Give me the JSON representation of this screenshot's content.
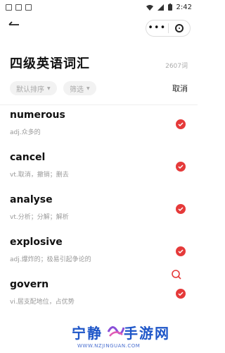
{
  "status": {
    "time": "2:42"
  },
  "nav": {
    "back_icon": "back-arrow-icon",
    "more_label": "•••",
    "close_icon": "close-circle-icon"
  },
  "header": {
    "title": "四级英语词汇",
    "count": "2607词"
  },
  "filters": {
    "sort_label": "默认排序",
    "filter_label": "筛选",
    "cancel_label": "取消"
  },
  "words": [
    {
      "word": "numerous",
      "meaning": "adj.众多的"
    },
    {
      "word": "cancel",
      "meaning": "vt.取消，撤销；删去"
    },
    {
      "word": "analyse",
      "meaning": "vt.分析；分解；解析"
    },
    {
      "word": "explosive",
      "meaning": "adj.爆炸的；极易引起争论的"
    },
    {
      "word": "govern",
      "meaning": "vi.居支配地位，占优势"
    }
  ],
  "watermark": {
    "main_left": "宁静",
    "main_right": "手游网",
    "sub": "WWW.NZJINGUAN.COM"
  },
  "colors": {
    "accent": "#e53a3a",
    "watermark": "#1e56c8"
  }
}
